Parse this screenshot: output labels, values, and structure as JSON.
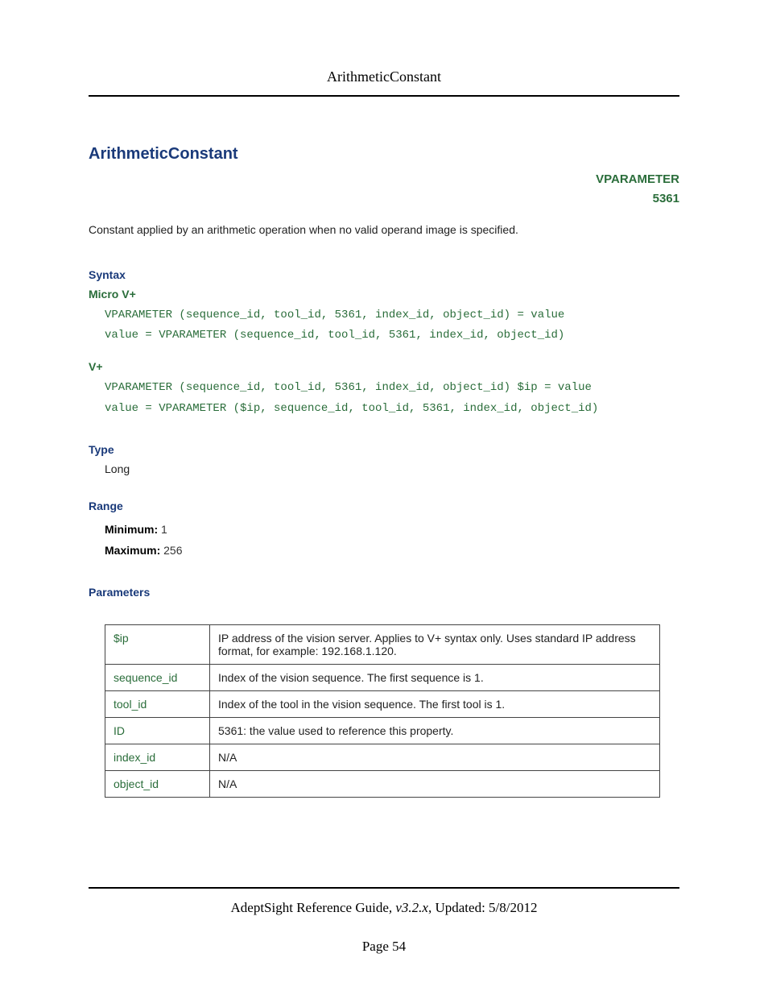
{
  "header": {
    "running_title": "ArithmeticConstant"
  },
  "title": "ArithmeticConstant",
  "vparameter": {
    "label": "VPARAMETER",
    "code": "5361"
  },
  "summary": "Constant applied by an arithmetic operation when no valid operand image is specified.",
  "sections": {
    "syntax": {
      "heading": "Syntax",
      "micro": {
        "label": "Micro V+",
        "line1": "VPARAMETER (sequence_id, tool_id, 5361, index_id, object_id) = value",
        "line2": "value = VPARAMETER (sequence_id, tool_id, 5361, index_id, object_id)"
      },
      "vplus": {
        "label": "V+",
        "line1": "VPARAMETER (sequence_id, tool_id, 5361, index_id, object_id) $ip = value",
        "line2": "value = VPARAMETER ($ip, sequence_id, tool_id, 5361, index_id, object_id)"
      }
    },
    "type": {
      "heading": "Type",
      "value": "Long"
    },
    "range": {
      "heading": "Range",
      "min_label": "Minimum:",
      "min_value": "1",
      "max_label": "Maximum:",
      "max_value": "256"
    },
    "parameters": {
      "heading": "Parameters",
      "rows": [
        {
          "name": "$ip",
          "desc": "IP address of the vision server. Applies to V+ syntax only. Uses standard IP address format, for example: 192.168.1.120."
        },
        {
          "name": "sequence_id",
          "desc": "Index of the vision sequence. The first sequence is 1."
        },
        {
          "name": "tool_id",
          "desc": "Index of the tool in the vision sequence. The first tool is 1."
        },
        {
          "name": "ID",
          "desc": "5361: the value used to reference this property."
        },
        {
          "name": "index_id",
          "desc": "N/A"
        },
        {
          "name": "object_id",
          "desc": "N/A"
        }
      ]
    }
  },
  "footer": {
    "guide": "AdeptSight Reference Guide",
    "version": ", v3.2.x",
    "updated": ", Updated: 5/8/2012",
    "page_label": "Page 54"
  }
}
